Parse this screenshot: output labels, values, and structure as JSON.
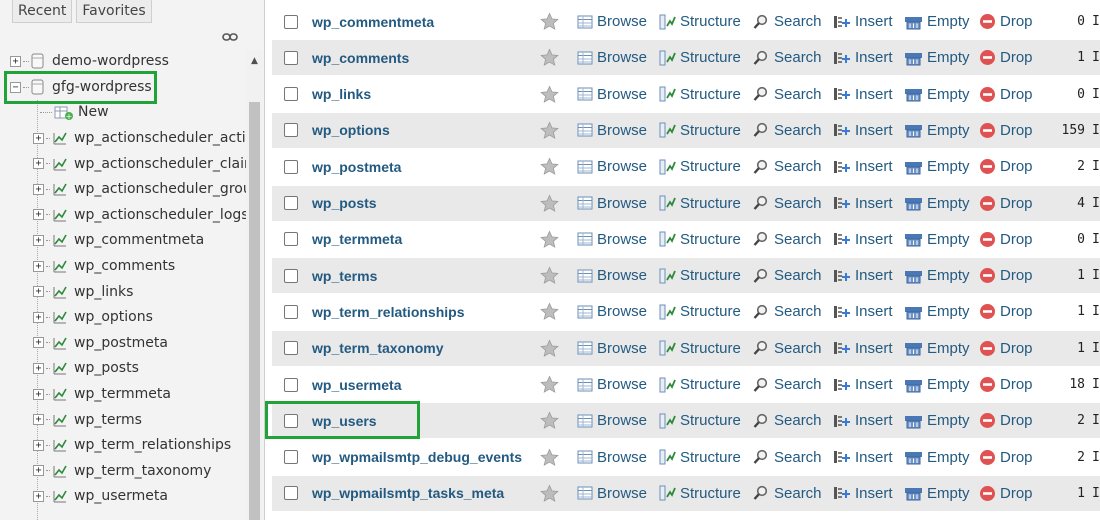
{
  "nav": {
    "tabs": [
      "Recent",
      "Favorites"
    ],
    "databases": [
      {
        "name": "demo-wordpress",
        "expanded": false
      },
      {
        "name": "gfg-wordpress",
        "expanded": true
      }
    ],
    "new_label": "New",
    "tables": [
      "wp_actionscheduler_actio",
      "wp_actionscheduler_claim",
      "wp_actionscheduler_group",
      "wp_actionscheduler_logs",
      "wp_commentmeta",
      "wp_comments",
      "wp_links",
      "wp_options",
      "wp_postmeta",
      "wp_posts",
      "wp_termmeta",
      "wp_terms",
      "wp_term_relationships",
      "wp_term_taxonomy",
      "wp_usermeta"
    ]
  },
  "actions": {
    "browse": "Browse",
    "structure": "Structure",
    "search": "Search",
    "insert": "Insert",
    "empty": "Empty",
    "drop": "Drop"
  },
  "tables": [
    {
      "name": "wp_commentmeta",
      "rows": "0",
      "trunc": "I"
    },
    {
      "name": "wp_comments",
      "rows": "1",
      "trunc": "I"
    },
    {
      "name": "wp_links",
      "rows": "0",
      "trunc": "I"
    },
    {
      "name": "wp_options",
      "rows": "159",
      "trunc": "I"
    },
    {
      "name": "wp_postmeta",
      "rows": "2",
      "trunc": "I"
    },
    {
      "name": "wp_posts",
      "rows": "4",
      "trunc": "I"
    },
    {
      "name": "wp_termmeta",
      "rows": "0",
      "trunc": "I"
    },
    {
      "name": "wp_terms",
      "rows": "1",
      "trunc": "I"
    },
    {
      "name": "wp_term_relationships",
      "rows": "1",
      "trunc": "I"
    },
    {
      "name": "wp_term_taxonomy",
      "rows": "1",
      "trunc": "I"
    },
    {
      "name": "wp_usermeta",
      "rows": "18",
      "trunc": "I"
    },
    {
      "name": "wp_users",
      "rows": "2",
      "trunc": "I"
    },
    {
      "name": "wp_wpmailsmtp_debug_events",
      "rows": "2",
      "trunc": "I"
    },
    {
      "name": "wp_wpmailsmtp_tasks_meta",
      "rows": "1",
      "trunc": "I"
    }
  ],
  "highlight_color": "#22a33a"
}
